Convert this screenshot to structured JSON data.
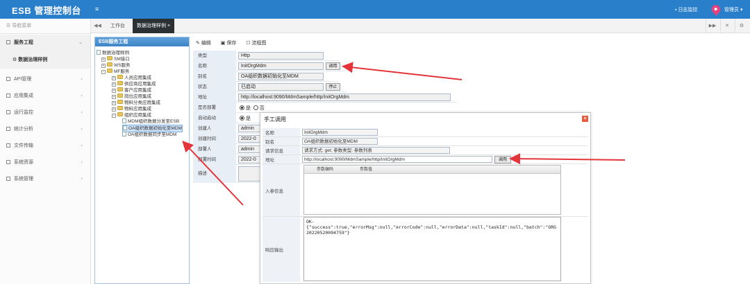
{
  "header": {
    "title": "ESB 管理控制台",
    "menu_icon": "≡",
    "log_monitor": "日志监控",
    "user": "管理员"
  },
  "sidebar": {
    "nav_title": "导航菜单",
    "items": [
      {
        "label": "服务工程",
        "chev": "⌄"
      },
      {
        "label": "数据治理样例"
      },
      {
        "label": "API管理",
        "chev": "‹"
      },
      {
        "label": "应用集成",
        "chev": "‹"
      },
      {
        "label": "运行监控",
        "chev": "‹"
      },
      {
        "label": "统计分析",
        "chev": "‹"
      },
      {
        "label": "文件传输",
        "chev": "‹"
      },
      {
        "label": "系统资源",
        "chev": "‹"
      },
      {
        "label": "系统管理",
        "chev": "‹"
      }
    ]
  },
  "tabs": {
    "prev": "◀◀",
    "workbench": "工作台",
    "active": "数据治理样例",
    "close": "×",
    "next": "▶▶",
    "fullscreen": "✕",
    "settings": "⚙"
  },
  "toolbar": {
    "edit": "编辑",
    "save": "保存",
    "flow": "流程图"
  },
  "tree": {
    "title": "ESB服务工程",
    "root": "数据治理样例",
    "nodes": [
      "SM接口",
      "WS服务",
      "MF服务",
      "人员应用集成",
      "供应商应用集成",
      "客户应用集成",
      "岗位应用集成",
      "物料分类应用集成",
      "物料应用集成",
      "组织应用集成",
      "MDM组织数据分发至ESB",
      "OA组织数据初始化至MDM",
      "OA组织数据同步至MDM"
    ]
  },
  "form": {
    "type_label": "类型",
    "type_value": "Http",
    "name_label": "名称",
    "name_value": "InitOrgMdm",
    "call_btn": "调用",
    "alias_label": "别名",
    "alias_value": "OA组织数据初始化至MDM",
    "status_label": "状态",
    "status_value": "已启动",
    "stop_btn": "停止",
    "addr_label": "地址",
    "addr_value": "http://localhost:9090/MdmSample/http/InitOrgMdm",
    "deploy_label": "是否部署",
    "yes": "是",
    "no": "否",
    "auto_label": "自动启动",
    "creator_label": "创建人",
    "creator_value": "admin",
    "ctime_label": "创建时间",
    "ctime_value": "2022-0",
    "deployer_label": "部署人",
    "deployer_value": "admin",
    "dtime_label": "部署时间",
    "dtime_value": "2022-0",
    "desc_label": "描述"
  },
  "dialog": {
    "title": "手工调用",
    "close": "×",
    "name_label": "名称",
    "name_value": "InitOrgMdm",
    "alias_label": "别名",
    "alias_value": "OA组织数据初始化至MDM",
    "req_label": "请求信息",
    "req_value": "请求方式: get; 参数类型: 参数列表",
    "addr_label": "地址",
    "addr_value": "http://localhost:9090/MdmSample/http/InitOrgMdm",
    "call_btn": "调用",
    "input_label": "入参信息",
    "col_code": "参数编码",
    "col_value": "参数值",
    "output_label": "响应输出",
    "output_text": "OK-\n{\"success\":true,\"errorMsg\":null,\"errorCode\":null,\"errorData\":null,\"taskId\":null,\"batch\":\"ORG20220520094759\"}"
  },
  "colors": {
    "header": "#2a7fcb",
    "active_tab": "#2b3035",
    "arrow": "#e3343a"
  }
}
